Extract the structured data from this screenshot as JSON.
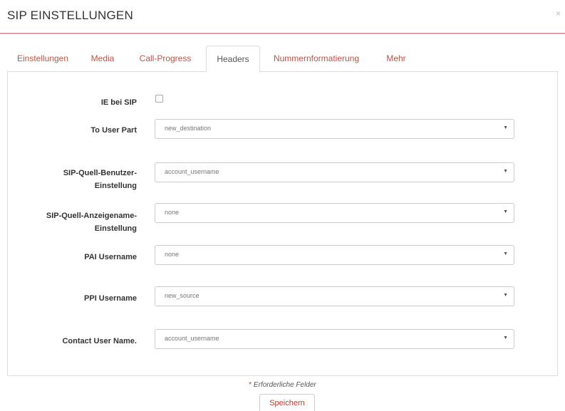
{
  "dialog": {
    "title": "SIP EINSTELLUNGEN",
    "close_glyph": "×"
  },
  "tabs": [
    {
      "label": "Einstellungen",
      "active": false
    },
    {
      "label": "Media",
      "active": false
    },
    {
      "label": "Call-Progress",
      "active": false
    },
    {
      "label": "Headers",
      "active": true
    },
    {
      "label": "Nummernformatierung",
      "active": false
    },
    {
      "label": "Mehr",
      "active": false
    }
  ],
  "form": {
    "ie_bei_sip": {
      "label": "IE bei SIP",
      "checked": false
    },
    "to_user_part": {
      "label": "To User Part",
      "value": "new_destination"
    },
    "sip_quell_benutzer": {
      "label_line1": "SIP-Quell-Benutzer-",
      "label_line2": "Einstellung",
      "value": "account_username"
    },
    "sip_quell_anzeigename": {
      "label_line1": "SIP-Quell-Anzeigename-",
      "label_line2": "Einstellung",
      "value": "none"
    },
    "pai_username": {
      "label": "PAI Username",
      "value": "none"
    },
    "ppi_username": {
      "label": "PPI Username",
      "value": "new_source"
    },
    "contact_user_name": {
      "label": "Contact User Name.",
      "value": "account_username"
    }
  },
  "footer": {
    "required_star": "*",
    "required_text": " Erforderliche Felder",
    "save_label": "Speichern"
  },
  "colors": {
    "accent": "#c0392b",
    "tab_link": "#b8554a",
    "header_rule": "#e4a0a0"
  },
  "icons": {
    "close": "close-icon",
    "select_caret": "caret-down-icon"
  }
}
